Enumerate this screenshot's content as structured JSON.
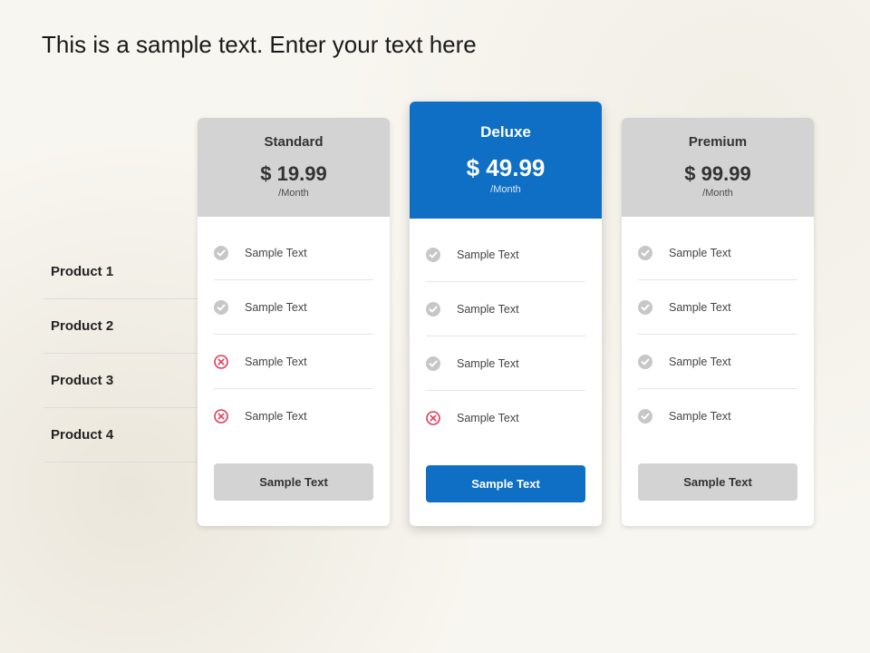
{
  "title": "This is a sample text. Enter your text here",
  "row_labels": [
    "Product 1",
    "Product 2",
    "Product 3",
    "Product 4"
  ],
  "feature_text": "Sample Text",
  "period": "/Month",
  "plans": [
    {
      "name": "Standard",
      "price": "$ 19.99",
      "featured": false,
      "cta": "Sample Text",
      "cta_style": "grey",
      "features": [
        {
          "icon": "check"
        },
        {
          "icon": "check"
        },
        {
          "icon": "cross"
        },
        {
          "icon": "cross"
        }
      ]
    },
    {
      "name": "Deluxe",
      "price": "$ 49.99",
      "featured": true,
      "cta": "Sample Text",
      "cta_style": "blue",
      "features": [
        {
          "icon": "check"
        },
        {
          "icon": "check"
        },
        {
          "icon": "check"
        },
        {
          "icon": "cross"
        }
      ]
    },
    {
      "name": "Premium",
      "price": "$ 99.99",
      "featured": false,
      "cta": "Sample Text",
      "cta_style": "grey",
      "features": [
        {
          "icon": "check"
        },
        {
          "icon": "check"
        },
        {
          "icon": "check"
        },
        {
          "icon": "check"
        }
      ]
    }
  ]
}
